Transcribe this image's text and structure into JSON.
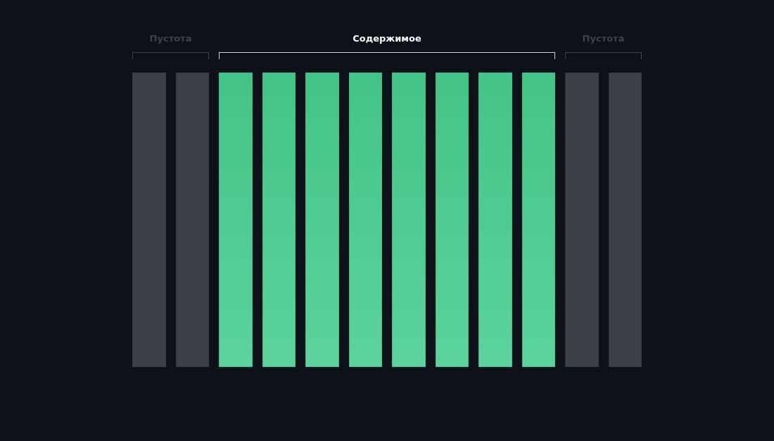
{
  "groups": [
    {
      "label": "Пустота",
      "kind": "empty",
      "columns": [
        {
          "kind": "empty"
        },
        {
          "kind": "empty"
        }
      ]
    },
    {
      "label": "Содержимое",
      "kind": "content",
      "columns": [
        {
          "kind": "content"
        },
        {
          "kind": "content"
        },
        {
          "kind": "content"
        },
        {
          "kind": "content"
        },
        {
          "kind": "content"
        },
        {
          "kind": "content"
        },
        {
          "kind": "content"
        },
        {
          "kind": "content"
        }
      ]
    },
    {
      "label": "Пустота",
      "kind": "empty",
      "columns": [
        {
          "kind": "empty"
        },
        {
          "kind": "empty"
        }
      ]
    }
  ]
}
